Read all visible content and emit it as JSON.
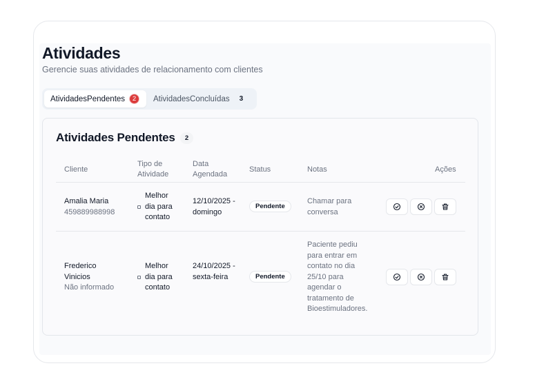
{
  "header": {
    "title": "Atividades",
    "subtitle": "Gerencie suas atividades de relacionamento com clientes"
  },
  "tabs": [
    {
      "label": "AtividadesPendentes",
      "count": "2",
      "active": true
    },
    {
      "label": "AtividadesConcluídas",
      "count": "3",
      "active": false
    }
  ],
  "card": {
    "title": "Atividades Pendentes",
    "count": "2",
    "columns": {
      "client": "Cliente",
      "type": "Tipo de Atividade",
      "date": "Data Agendada",
      "status": "Status",
      "notes": "Notas",
      "actions": "Ações"
    },
    "rows": [
      {
        "client_name": "Amalia Maria",
        "client_sub": "459889988998",
        "type": "Melhor dia para contato",
        "date": "12/10/2025 - domingo",
        "status": "Pendente",
        "notes": "Chamar para conversa"
      },
      {
        "client_name": "Frederico Vinicios",
        "client_sub": "Não informado",
        "type": "Melhor dia para contato",
        "date": "24/10/2025 - sexta-feira",
        "status": "Pendente",
        "notes": "Paciente pediu para entrar em contato no dia 25/10 para agendar o tratamento de Bioestimuladores."
      }
    ]
  },
  "icons": {
    "complete": "circle-check-icon",
    "cancel": "circle-x-icon",
    "delete": "trash-icon"
  },
  "colors": {
    "badge_red": "#dc3b3b"
  }
}
